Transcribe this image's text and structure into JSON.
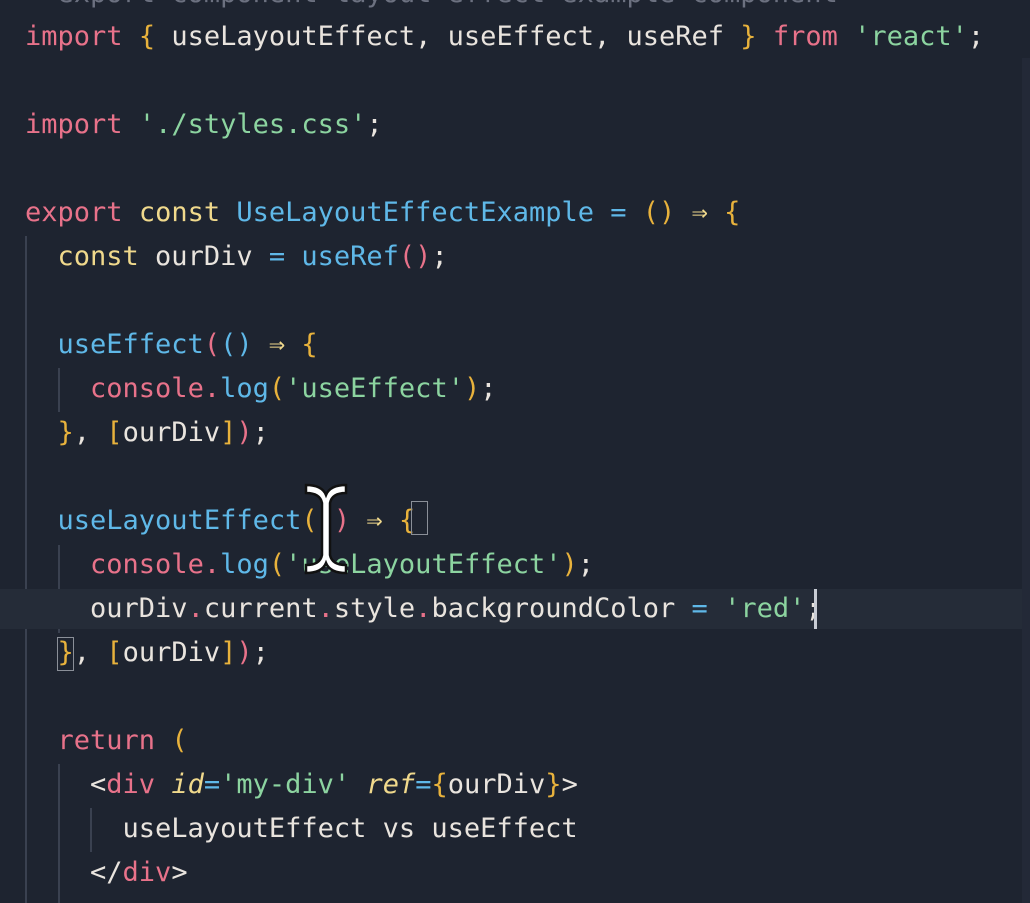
{
  "editor": {
    "top_partial_line": "  export component layout effect example component  ",
    "lines": [
      {
        "tokens": [
          {
            "t": "import",
            "c": "kw"
          },
          {
            "t": " ",
            "c": "var"
          },
          {
            "t": "{",
            "c": "br1"
          },
          {
            "t": " useLayoutEffect, useEffect, useRef ",
            "c": "var"
          },
          {
            "t": "}",
            "c": "br1"
          },
          {
            "t": " ",
            "c": "var"
          },
          {
            "t": "from",
            "c": "kw"
          },
          {
            "t": " ",
            "c": "var"
          },
          {
            "t": "'react'",
            "c": "str"
          },
          {
            "t": ";",
            "c": "punc"
          }
        ]
      },
      {
        "tokens": []
      },
      {
        "tokens": [
          {
            "t": "import",
            "c": "kw"
          },
          {
            "t": " ",
            "c": "var"
          },
          {
            "t": "'./styles.css'",
            "c": "str"
          },
          {
            "t": ";",
            "c": "punc"
          }
        ]
      },
      {
        "tokens": []
      },
      {
        "tokens": [
          {
            "t": "export",
            "c": "kw"
          },
          {
            "t": " ",
            "c": "var"
          },
          {
            "t": "const",
            "c": "cst"
          },
          {
            "t": " ",
            "c": "var"
          },
          {
            "t": "UseLayoutEffectExample",
            "c": "fn"
          },
          {
            "t": " ",
            "c": "var"
          },
          {
            "t": "=",
            "c": "op"
          },
          {
            "t": " ",
            "c": "var"
          },
          {
            "t": "()",
            "c": "br1"
          },
          {
            "t": " ",
            "c": "var"
          },
          {
            "t": "⇒",
            "c": "cst"
          },
          {
            "t": " ",
            "c": "var"
          },
          {
            "t": "{",
            "c": "br1"
          }
        ]
      },
      {
        "tokens": [
          {
            "t": "  ",
            "c": "var"
          },
          {
            "t": "const",
            "c": "cst"
          },
          {
            "t": " ourDiv ",
            "c": "var"
          },
          {
            "t": "=",
            "c": "op"
          },
          {
            "t": " ",
            "c": "var"
          },
          {
            "t": "useRef",
            "c": "fn"
          },
          {
            "t": "()",
            "c": "br2"
          },
          {
            "t": ";",
            "c": "punc"
          }
        ]
      },
      {
        "tokens": []
      },
      {
        "tokens": [
          {
            "t": "  ",
            "c": "var"
          },
          {
            "t": "useEffect",
            "c": "fn"
          },
          {
            "t": "(",
            "c": "br2"
          },
          {
            "t": "()",
            "c": "br3"
          },
          {
            "t": " ",
            "c": "var"
          },
          {
            "t": "⇒",
            "c": "cst"
          },
          {
            "t": " ",
            "c": "var"
          },
          {
            "t": "{",
            "c": "br1"
          }
        ]
      },
      {
        "tokens": [
          {
            "t": "    ",
            "c": "var"
          },
          {
            "t": "console",
            "c": "kw"
          },
          {
            "t": ".",
            "c": "dot"
          },
          {
            "t": "log",
            "c": "fn"
          },
          {
            "t": "(",
            "c": "br1"
          },
          {
            "t": "'useEffect'",
            "c": "str"
          },
          {
            "t": ")",
            "c": "br1"
          },
          {
            "t": ";",
            "c": "punc"
          }
        ]
      },
      {
        "tokens": [
          {
            "t": "  ",
            "c": "var"
          },
          {
            "t": "}",
            "c": "br1"
          },
          {
            "t": ", ",
            "c": "punc"
          },
          {
            "t": "[",
            "c": "br1"
          },
          {
            "t": "ourDiv",
            "c": "var"
          },
          {
            "t": "]",
            "c": "br1"
          },
          {
            "t": ")",
            "c": "br2"
          },
          {
            "t": ";",
            "c": "punc"
          }
        ]
      },
      {
        "tokens": []
      },
      {
        "tokens": [
          {
            "t": "  ",
            "c": "var"
          },
          {
            "t": "useLayoutEffect",
            "c": "fn"
          },
          {
            "t": "(",
            "c": "br1"
          },
          {
            "t": "()",
            "c": "br2"
          },
          {
            "t": " ",
            "c": "var"
          },
          {
            "t": "⇒",
            "c": "cst"
          },
          {
            "t": " ",
            "c": "var"
          },
          {
            "t": "{",
            "c": "br1"
          }
        ]
      },
      {
        "tokens": [
          {
            "t": "    ",
            "c": "var"
          },
          {
            "t": "console",
            "c": "kw"
          },
          {
            "t": ".",
            "c": "dot"
          },
          {
            "t": "log",
            "c": "fn"
          },
          {
            "t": "(",
            "c": "br1"
          },
          {
            "t": "'useLayoutEffect'",
            "c": "str"
          },
          {
            "t": ")",
            "c": "br1"
          },
          {
            "t": ";",
            "c": "punc"
          }
        ]
      },
      {
        "tokens": [
          {
            "t": "    ourDiv",
            "c": "var"
          },
          {
            "t": ".",
            "c": "dot"
          },
          {
            "t": "current",
            "c": "var"
          },
          {
            "t": ".",
            "c": "dot"
          },
          {
            "t": "style",
            "c": "var"
          },
          {
            "t": ".",
            "c": "dot"
          },
          {
            "t": "backgroundColor",
            "c": "var"
          },
          {
            "t": " ",
            "c": "var"
          },
          {
            "t": "=",
            "c": "op"
          },
          {
            "t": " ",
            "c": "var"
          },
          {
            "t": "'red'",
            "c": "str"
          },
          {
            "t": ";",
            "c": "punc"
          }
        ]
      },
      {
        "tokens": [
          {
            "t": "  ",
            "c": "var"
          },
          {
            "t": "}",
            "c": "br1"
          },
          {
            "t": ", ",
            "c": "punc"
          },
          {
            "t": "[",
            "c": "br1"
          },
          {
            "t": "ourDiv",
            "c": "var"
          },
          {
            "t": "]",
            "c": "br1"
          },
          {
            "t": ")",
            "c": "br2"
          },
          {
            "t": ";",
            "c": "punc"
          }
        ]
      },
      {
        "tokens": []
      },
      {
        "tokens": [
          {
            "t": "  ",
            "c": "var"
          },
          {
            "t": "return",
            "c": "kw"
          },
          {
            "t": " ",
            "c": "var"
          },
          {
            "t": "(",
            "c": "br1"
          }
        ]
      },
      {
        "tokens": [
          {
            "t": "    ",
            "c": "var"
          },
          {
            "t": "<",
            "c": "punc"
          },
          {
            "t": "div",
            "c": "tag"
          },
          {
            "t": " ",
            "c": "var"
          },
          {
            "t": "id",
            "c": "attr"
          },
          {
            "t": "=",
            "c": "op"
          },
          {
            "t": "'my-div'",
            "c": "str"
          },
          {
            "t": " ",
            "c": "var"
          },
          {
            "t": "ref",
            "c": "attr"
          },
          {
            "t": "=",
            "c": "op"
          },
          {
            "t": "{",
            "c": "br1"
          },
          {
            "t": "ourDiv",
            "c": "var"
          },
          {
            "t": "}",
            "c": "br1"
          },
          {
            "t": ">",
            "c": "punc"
          }
        ]
      },
      {
        "tokens": [
          {
            "t": "      useLayoutEffect vs useEffect",
            "c": "var"
          }
        ]
      },
      {
        "tokens": [
          {
            "t": "    ",
            "c": "var"
          },
          {
            "t": "</",
            "c": "punc"
          },
          {
            "t": "div",
            "c": "tag"
          },
          {
            "t": ">",
            "c": "punc"
          }
        ]
      }
    ],
    "active_line_index": 13,
    "colors": {
      "background": "#1e2430",
      "keyword": "#e8728a",
      "string": "#8cd4a0",
      "function": "#5fb8e8",
      "const": "#f0d98c",
      "bracket": "#e8b23c"
    },
    "cursor_icon": "text-ibeam-cursor-icon"
  }
}
